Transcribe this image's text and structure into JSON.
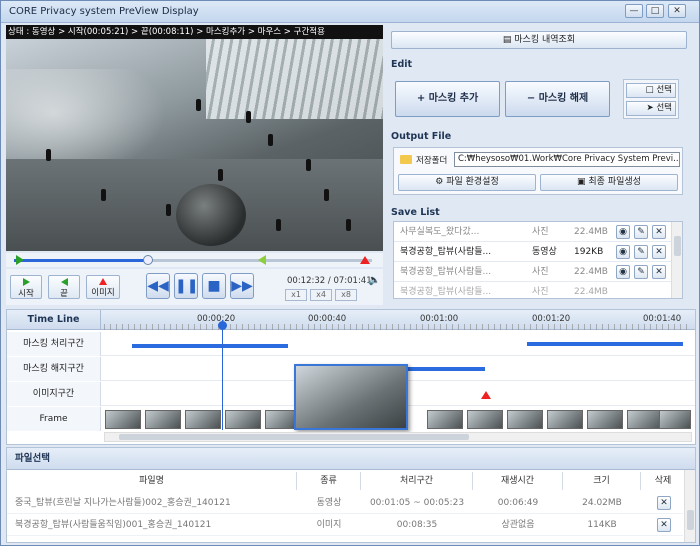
{
  "window": {
    "title": "CORE Privacy system PreView Display"
  },
  "video": {
    "status": "상태 : 동영상 > 시작(00:05:21) > 끝(00:08:11) > 마스킹추가 > 마우스 > 구간적용",
    "controls": {
      "start_label": "시작",
      "end_label": "끝",
      "image_label": "이미지",
      "time": "00:12:32 / 07:01:41",
      "zoom": [
        "x1",
        "x4",
        "x8"
      ]
    }
  },
  "right": {
    "masking_history": "마스킹 내역조회",
    "edit_title": "Edit",
    "add_masking": "+ 마스킹 추가",
    "remove_masking": "− 마스킹 해제",
    "select_a": "선택",
    "select_b": "선택",
    "output_title": "Output File",
    "save_folder_label": "저장폴더",
    "save_path": "C:₩heysoso₩01.Work₩Core Privacy System Previ...",
    "file_env": "파일 환경설정",
    "final_create": "최종 파일생성",
    "savelist_title": "Save List",
    "savelist": [
      {
        "name": "사무실복도_왔다갔...",
        "type": "사진",
        "size": "22.4MB",
        "muted": true
      },
      {
        "name": "북경공항_탑뷰(사람들...",
        "type": "동영상",
        "size": "192KB",
        "muted": false
      },
      {
        "name": "북경공항_탑뷰(사람들...",
        "type": "사진",
        "size": "22.4MB",
        "muted": true
      },
      {
        "name": "북경공항_탑뷰(사람들...",
        "type": "사진",
        "size": "22.4MB",
        "muted": true
      }
    ]
  },
  "timeline": {
    "title": "Time Line",
    "ticks": [
      "00:00:20",
      "00:00:40",
      "00:01:00",
      "00:01:20",
      "00:01:40"
    ],
    "rows": [
      "마스킹 처리구간",
      "마스킹 해지구간",
      "이미지구간",
      "Frame"
    ]
  },
  "files": {
    "title": "파일선택",
    "headers": [
      "파일명",
      "종류",
      "처리구간",
      "재생시간",
      "크기",
      "삭제"
    ],
    "rows": [
      {
        "name": "중국_탑뷰(흐린날 지나가는사람들)002_홍승권_140121",
        "type": "동영상",
        "range": "00:01:05 ~ 00:05:23",
        "duration": "00:06:49",
        "size": "24.02MB"
      },
      {
        "name": "북경공항_탑뷰(사람들움직임)001_홍승권_140121",
        "type": "이미지",
        "range": "00:08:35",
        "duration": "상관없음",
        "size": "114KB"
      }
    ]
  },
  "colors": {
    "accent": "#2a6be0",
    "marker_red": "#e22222",
    "marker_green": "#2aa02a"
  }
}
